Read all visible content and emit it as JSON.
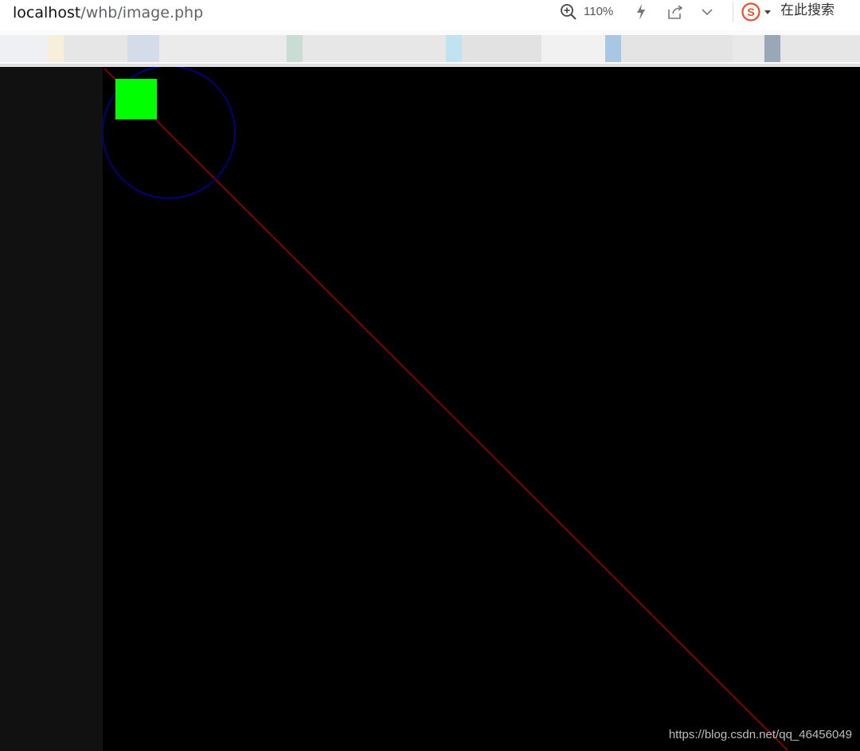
{
  "browser": {
    "url_host": "localhost",
    "url_path": "/whb/image.php",
    "zoom_label": "110%",
    "search_label": "在此搜索",
    "icons": [
      "zoom-in-icon",
      "lightning-icon",
      "share-icon",
      "chevron-down-icon",
      "sogou-search-icon",
      "dropdown-arrow-icon"
    ]
  },
  "bookmarks_bar": {
    "blurred": true
  },
  "image": {
    "background_color": "#000000",
    "shapes": [
      {
        "type": "line",
        "color": "#aa0000"
      },
      {
        "type": "circle",
        "color": "#0000aa"
      },
      {
        "type": "filled-rectangle",
        "color": "#00ff00"
      }
    ]
  },
  "watermark": "https://blog.csdn.net/qq_46456049"
}
